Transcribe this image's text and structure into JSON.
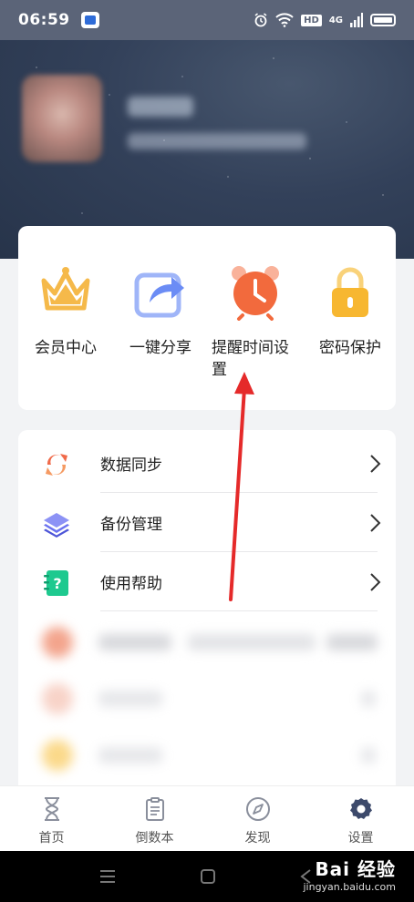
{
  "status_bar": {
    "time": "06:59",
    "hd_label": "HD",
    "network_label": "4G"
  },
  "quick_actions": [
    {
      "label": "会员中心",
      "icon": "crown-icon"
    },
    {
      "label": "一键分享",
      "icon": "share-icon"
    },
    {
      "label": "提醒时间设置",
      "icon": "alarm-clock-icon"
    },
    {
      "label": "密码保护",
      "icon": "lock-icon"
    }
  ],
  "menu_items": [
    {
      "label": "数据同步",
      "icon": "sync-icon"
    },
    {
      "label": "备份管理",
      "icon": "layers-icon"
    },
    {
      "label": "使用帮助",
      "icon": "help-notebook-icon"
    }
  ],
  "tabs": [
    {
      "label": "首页",
      "icon": "hourglass-icon"
    },
    {
      "label": "倒数本",
      "icon": "clipboard-icon"
    },
    {
      "label": "发现",
      "icon": "compass-icon"
    },
    {
      "label": "设置",
      "icon": "gear-icon",
      "active": true
    }
  ],
  "watermark": {
    "main": "Bai 经验",
    "sub": "jingyan.baidu.com"
  },
  "colors": {
    "crown": "#f5b94a",
    "share": "#6b8cf5",
    "alarm": "#f26a3d",
    "lock": "#f7b731",
    "sync": "#f06a4a",
    "layers": "#6a72f0",
    "help": "#1ec98f",
    "annotation": "#e52a2a"
  }
}
